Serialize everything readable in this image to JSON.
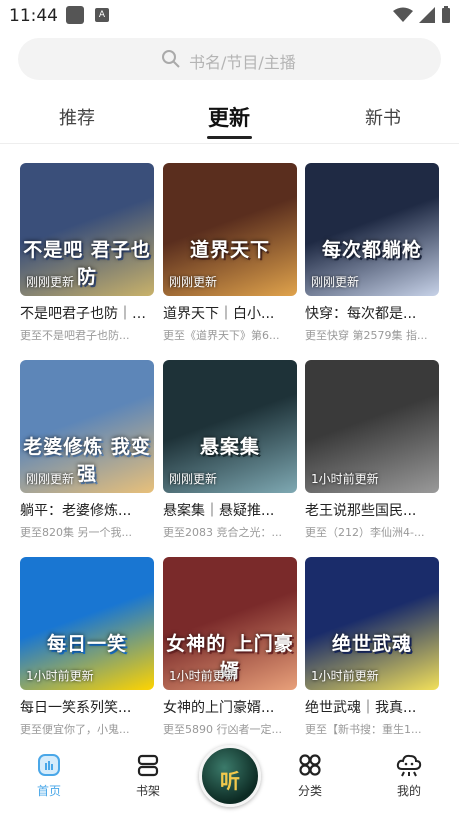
{
  "status": {
    "time": "11:44",
    "a_label": "A"
  },
  "search": {
    "placeholder": "书名/节目/主播"
  },
  "tabs": [
    {
      "label": "推荐"
    },
    {
      "label": "更新"
    },
    {
      "label": "新书"
    }
  ],
  "books": [
    {
      "title": "不是吧君子也防｜古...",
      "sub": "更至不是吧君子也防...",
      "badge": "刚刚更新",
      "cover_text": "不是吧 君子也防",
      "colors": [
        "#3a4f7a",
        "#c9b26a"
      ]
    },
    {
      "title": "道界天下｜白小...",
      "sub": "更至《道界天下》第6...",
      "badge": "刚刚更新",
      "cover_text": "道界天下",
      "colors": [
        "#5a2e1e",
        "#e0a34c"
      ]
    },
    {
      "title": "快穿：每次都是...",
      "sub": "更至快穿 第2579集 指...",
      "badge": "刚刚更新",
      "cover_text": "每次都躺枪",
      "colors": [
        "#1f2a44",
        "#c7d2e8"
      ]
    },
    {
      "title": "躺平：老婆修炼...",
      "sub": "更至820集 另一个我...",
      "badge": "刚刚更新",
      "cover_text": "老婆修炼 我变强",
      "colors": [
        "#5d86b8",
        "#e8c07a"
      ]
    },
    {
      "title": "悬案集｜悬疑推...",
      "sub": "更至2083 竞合之光：...",
      "badge": "刚刚更新",
      "cover_text": "悬案集",
      "colors": [
        "#1e3238",
        "#7fa9b3"
      ]
    },
    {
      "title": "老王说那些国民...",
      "sub": "更至（212）李仙洲4-...",
      "badge": "1小时前更新",
      "cover_text": "",
      "colors": [
        "#3a3a3a",
        "#9a9a9a"
      ]
    },
    {
      "title": "每日一笑系列笑...",
      "sub": "更至便宜你了，小鬼...",
      "badge": "1小时前更新",
      "cover_text": "每日一笑",
      "colors": [
        "#1976d2",
        "#ffd400"
      ]
    },
    {
      "title": "女神的上门豪婿...",
      "sub": "更至5890 行凶者一定...",
      "badge": "1小时前更新",
      "cover_text": "女神的 上门豪婿",
      "colors": [
        "#7a2a2a",
        "#e8a07a"
      ]
    },
    {
      "title": "绝世武魂｜我真...",
      "sub": "更至【新书搜：重生1...",
      "badge": "1小时前更新",
      "cover_text": "绝世武魂",
      "colors": [
        "#1a2c6a",
        "#f2e05a"
      ]
    }
  ],
  "nav": [
    {
      "label": "首页"
    },
    {
      "label": "书架"
    },
    {
      "label": "分类"
    },
    {
      "label": "我的"
    }
  ],
  "center_disc": {
    "label": "听"
  },
  "accent": "#4aa7e8"
}
